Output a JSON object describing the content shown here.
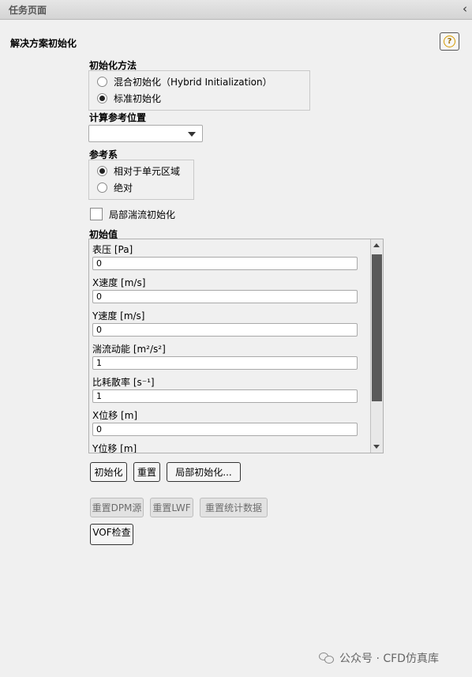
{
  "window": {
    "title": "任务页面",
    "collapse_glyph": "‹"
  },
  "panel": {
    "title": "解决方案初始化",
    "help_glyph": "?"
  },
  "init_method": {
    "label": "初始化方法",
    "options": [
      {
        "label": "混合初始化（Hybrid Initialization）",
        "selected": false
      },
      {
        "label": "标准初始化",
        "selected": true
      }
    ]
  },
  "compute_from": {
    "label": "计算参考位置",
    "value": ""
  },
  "reference_frame": {
    "label": "参考系",
    "options": [
      {
        "label": "相对于单元区域",
        "selected": true
      },
      {
        "label": "绝对",
        "selected": false
      }
    ]
  },
  "patch_turbulence": {
    "label": "局部湍流初始化",
    "checked": false
  },
  "initial_values": {
    "label": "初始值",
    "fields": [
      {
        "label": "表压 [Pa]",
        "value": "0"
      },
      {
        "label": "X速度 [m/s]",
        "value": "0"
      },
      {
        "label": "Y速度 [m/s]",
        "value": "0"
      },
      {
        "label": "湍流动能 [m²/s²]",
        "value": "1"
      },
      {
        "label": "比耗散率 [s⁻¹]",
        "value": "1"
      },
      {
        "label": "X位移 [m]",
        "value": "0"
      },
      {
        "label": "Y位移 [m]",
        "value": ""
      }
    ]
  },
  "buttons": {
    "initialize": "初始化",
    "reset": "重置",
    "patch": "局部初始化...",
    "reset_dpm": "重置DPM源",
    "reset_lwf": "重置LWF",
    "reset_stats": "重置统计数据",
    "vof_check": "VOF检查"
  },
  "watermark": "公众号 · CFD仿真库"
}
